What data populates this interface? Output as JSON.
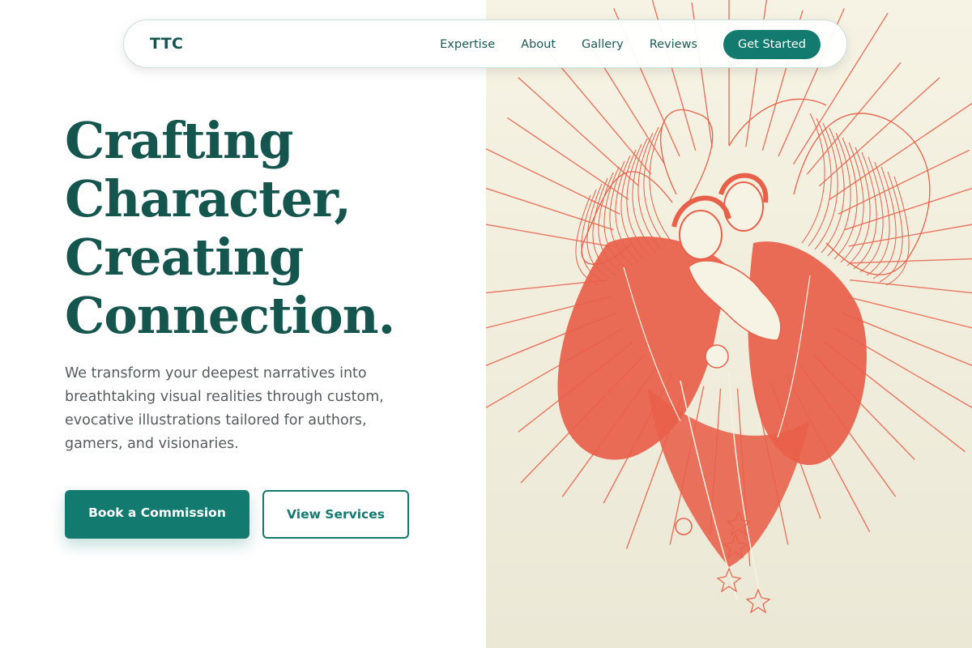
{
  "navbar": {
    "logo": "TTC",
    "links": [
      "Expertise",
      "About",
      "Gallery",
      "Reviews"
    ],
    "cta": "Get Started"
  },
  "hero": {
    "title_lines": [
      "Crafting",
      "Character,",
      "Creating",
      "Connection."
    ],
    "description": "We transform your deepest narratives into breathtaking visual realities through custom, evocative illustrations tailored for authors, gamers, and visionaries.",
    "primary_button": "Book a Commission",
    "secondary_button": "View Services"
  },
  "illustration": {
    "subject": "angels-engraving",
    "ink_color": "#e8604a",
    "paper_color": "#f4f1e1"
  },
  "colors": {
    "brand": "#137a70",
    "heading": "#14554d"
  }
}
